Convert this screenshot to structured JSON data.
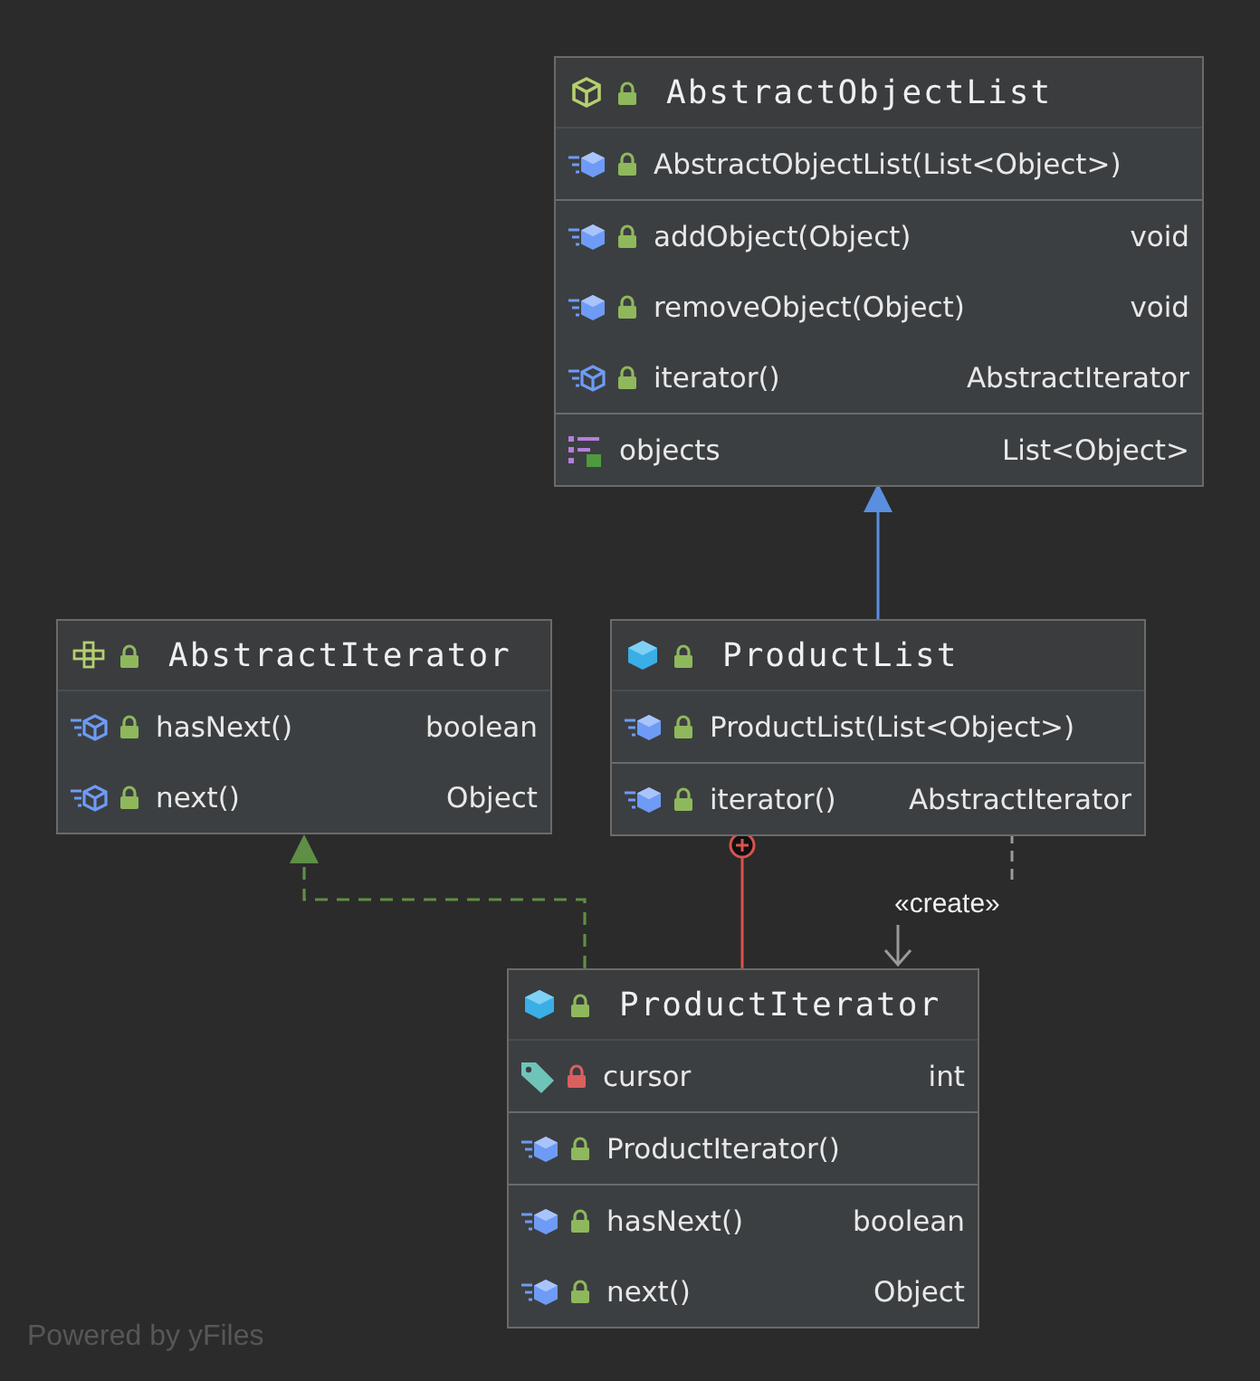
{
  "classes": [
    {
      "name": "AbstractObjectList",
      "kind": "abstract_class",
      "private": false,
      "sections": [
        [
          {
            "name": "AbstractObjectList(List<Object>)",
            "kind": "method",
            "abstract": false,
            "private": false
          }
        ],
        [
          {
            "name": "addObject(Object)",
            "type": "void",
            "kind": "method",
            "abstract": false,
            "private": false
          },
          {
            "name": "removeObject(Object)",
            "type": "void",
            "kind": "method",
            "abstract": false,
            "private": false
          },
          {
            "name": "iterator()",
            "type": "AbstractIterator",
            "kind": "method",
            "abstract": true,
            "private": false
          }
        ],
        [
          {
            "name": "objects",
            "type": "List<Object>",
            "kind": "property"
          }
        ]
      ]
    },
    {
      "name": "AbstractIterator",
      "kind": "interface",
      "private": false,
      "sections": [
        [
          {
            "name": "hasNext()",
            "type": "boolean",
            "kind": "method",
            "abstract": true,
            "private": false
          },
          {
            "name": "next()",
            "type": "Object",
            "kind": "method",
            "abstract": true,
            "private": false
          }
        ]
      ]
    },
    {
      "name": "ProductList",
      "kind": "class",
      "private": false,
      "sections": [
        [
          {
            "name": "ProductList(List<Object>)",
            "kind": "method",
            "abstract": false,
            "private": false
          }
        ],
        [
          {
            "name": "iterator()",
            "type": "AbstractIterator",
            "kind": "method",
            "abstract": false,
            "private": false
          }
        ]
      ]
    },
    {
      "name": "ProductIterator",
      "kind": "class",
      "private": false,
      "sections": [
        [
          {
            "name": "cursor",
            "type": "int",
            "kind": "field",
            "private": true
          }
        ],
        [
          {
            "name": "ProductIterator()",
            "kind": "method",
            "abstract": false,
            "private": false
          }
        ],
        [
          {
            "name": "hasNext()",
            "type": "boolean",
            "kind": "method",
            "abstract": false,
            "private": false
          },
          {
            "name": "next()",
            "type": "Object",
            "kind": "method",
            "abstract": false,
            "private": false
          }
        ]
      ]
    }
  ],
  "edges": [
    {
      "kind": "generalization"
    },
    {
      "kind": "realization"
    },
    {
      "kind": "nested"
    },
    {
      "kind": "dependency",
      "label": "«create»"
    }
  ],
  "footer": "Powered by yFiles"
}
